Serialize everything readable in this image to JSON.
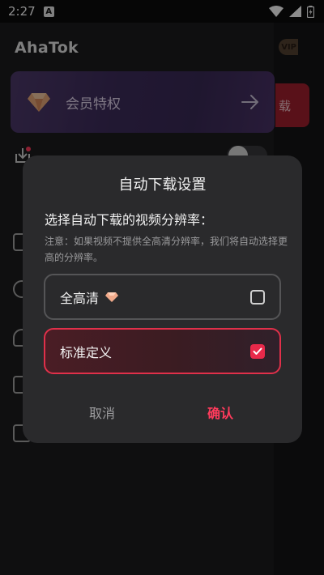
{
  "status_bar": {
    "time": "2:27",
    "notification_letter": "A",
    "icons": [
      "wifi-icon",
      "signal-icon",
      "battery-icon"
    ]
  },
  "drawer": {
    "app_title": "AhaTok",
    "member_card_label": "会员特权",
    "side_badge": "VIP",
    "side_chip_text": "载"
  },
  "dialog": {
    "title": "自动下载设置",
    "subtitle": "选择自动下载的视频分辨率：",
    "note": "注意：如果视频不提供全高清分辨率，我们将自动选择更高的分辨率。",
    "options": [
      {
        "label": "全高清",
        "premium": true,
        "checked": false
      },
      {
        "label": "标准定义",
        "premium": false,
        "checked": true
      }
    ],
    "cancel_label": "取消",
    "confirm_label": "确认"
  },
  "colors": {
    "accent": "#ff3b5c",
    "dialog_bg": "#2a2a2c",
    "member_card": "#3d2c5c"
  }
}
